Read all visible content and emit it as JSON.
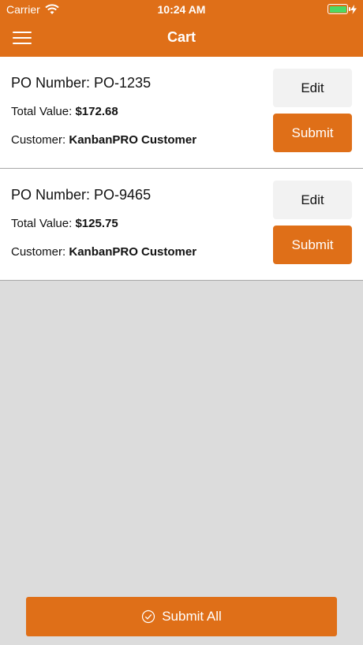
{
  "status_bar": {
    "carrier": "Carrier",
    "time": "10:24 AM",
    "battery_color": "#4cd964"
  },
  "nav": {
    "title": "Cart",
    "menu_icon": "hamburger-menu-icon"
  },
  "theme": {
    "accent": "#df6f18",
    "background": "#dcdcdc",
    "edit_button_bg": "#f2f2f2"
  },
  "orders": [
    {
      "po_label": "PO Number: PO-1235",
      "total_label": "Total Value: ",
      "total_value": "$172.68",
      "customer_label": "Customer: ",
      "customer_name": "KanbanPRO Customer",
      "edit_label": "Edit",
      "submit_label": "Submit"
    },
    {
      "po_label": "PO Number: PO-9465",
      "total_label": "Total Value: ",
      "total_value": "$125.75",
      "customer_label": "Customer: ",
      "customer_name": "KanbanPRO Customer",
      "edit_label": "Edit",
      "submit_label": "Submit"
    }
  ],
  "footer": {
    "submit_all_label": "Submit All",
    "submit_all_icon": "check-circle-icon"
  }
}
